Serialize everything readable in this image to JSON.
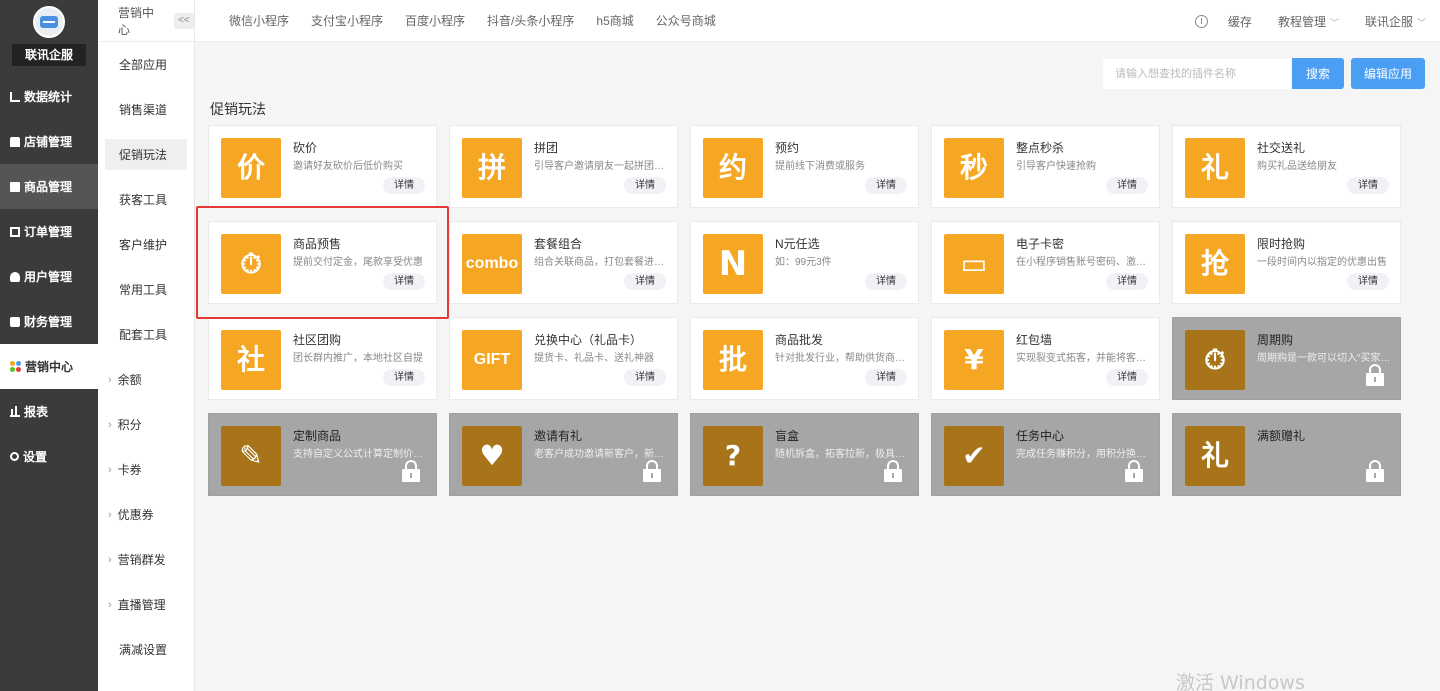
{
  "brand": {
    "name": "联讯企服"
  },
  "sidebar": {
    "items": [
      {
        "label": "数据统计",
        "icon": "chart-icon"
      },
      {
        "label": "店铺管理",
        "icon": "store-icon"
      },
      {
        "label": "商品管理",
        "icon": "goods-icon"
      },
      {
        "label": "订单管理",
        "icon": "order-icon"
      },
      {
        "label": "用户管理",
        "icon": "user-icon"
      },
      {
        "label": "财务管理",
        "icon": "finance-icon"
      },
      {
        "label": "营销中心",
        "icon": "marketing-icon"
      },
      {
        "label": "报表",
        "icon": "report-icon"
      },
      {
        "label": "设置",
        "icon": "gear-icon"
      }
    ]
  },
  "subnav": {
    "title": "营销中心",
    "collapse_label": "<<",
    "items": [
      {
        "label": "全部应用"
      },
      {
        "label": "销售渠道"
      },
      {
        "label": "促销玩法"
      },
      {
        "label": "获客工具"
      },
      {
        "label": "客户维护"
      },
      {
        "label": "常用工具"
      },
      {
        "label": "配套工具"
      },
      {
        "label": "余额"
      },
      {
        "label": "积分"
      },
      {
        "label": "卡券"
      },
      {
        "label": "优惠券"
      },
      {
        "label": "营销群发"
      },
      {
        "label": "直播管理"
      },
      {
        "label": "满减设置"
      }
    ]
  },
  "topbar": {
    "tabs": [
      "微信小程序",
      "支付宝小程序",
      "百度小程序",
      "抖音/头条小程序",
      "h5商城",
      "公众号商城"
    ],
    "cache": "缓存",
    "tutorial": "教程管理",
    "account": "联讯企服"
  },
  "toolbar": {
    "search_placeholder": "请输入想查找的插件名称",
    "search_button": "搜索",
    "edit_button": "编辑应用"
  },
  "section": {
    "title": "促销玩法"
  },
  "detail_label": "详情",
  "cards": [
    {
      "name": "砍价",
      "desc": "邀请好友砍价后低价购买",
      "glyph": "价",
      "icon": "bargain-icon",
      "locked": false
    },
    {
      "name": "拼团",
      "desc": "引导客户邀请朋友一起拼团购买",
      "glyph": "拼",
      "icon": "group-buy-icon",
      "locked": false
    },
    {
      "name": "预约",
      "desc": "提前线下消费或服务",
      "glyph": "约",
      "icon": "reservation-icon",
      "locked": false
    },
    {
      "name": "整点秒杀",
      "desc": "引导客户快速抢购",
      "glyph": "秒",
      "icon": "flash-sale-icon",
      "locked": false
    },
    {
      "name": "社交送礼",
      "desc": "购买礼品送给朋友",
      "glyph": "礼",
      "icon": "gift-icon",
      "locked": false
    },
    {
      "name": "商品预售",
      "desc": "提前交付定金，尾款享受优惠",
      "glyph": "⏱",
      "icon": "presale-bag-icon",
      "locked": false
    },
    {
      "name": "套餐组合",
      "desc": "组合关联商品，打包套餐进行销售",
      "glyph": "combo",
      "icon": "combo-icon",
      "locked": false
    },
    {
      "name": "N元任选",
      "desc": "如：99元3件",
      "glyph": "N",
      "icon": "n-yuan-icon",
      "locked": false
    },
    {
      "name": "电子卡密",
      "desc": "在小程序销售账号密码、激活码等",
      "glyph": "▭",
      "icon": "card-key-icon",
      "locked": false
    },
    {
      "name": "限时抢购",
      "desc": "一段时间内以指定的优惠出售",
      "glyph": "抢",
      "icon": "limited-time-icon",
      "locked": false
    },
    {
      "name": "社区团购",
      "desc": "团长群内推广，本地社区自提",
      "glyph": "社",
      "icon": "community-icon",
      "locked": false
    },
    {
      "name": "兑换中心（礼品卡）",
      "desc": "提货卡、礼品卡、送礼神器",
      "glyph": "GIFT",
      "icon": "gift-card-icon",
      "locked": false
    },
    {
      "name": "商品批发",
      "desc": "针对批发行业，帮助供货商快速拓客",
      "glyph": "批",
      "icon": "wholesale-icon",
      "locked": false
    },
    {
      "name": "红包墙",
      "desc": "实现裂变式拓客，并能将客户沉淀",
      "glyph": "¥",
      "icon": "red-packet-icon",
      "locked": false
    },
    {
      "name": "周期购",
      "desc": "周期购是一款可以切入“买家复购”的应用",
      "glyph": "⏱",
      "icon": "periodic-icon",
      "locked": true
    },
    {
      "name": "定制商品",
      "desc": "支持自定义公式计算定制价格的应用",
      "glyph": "✎",
      "icon": "custom-goods-icon",
      "locked": true
    },
    {
      "name": "邀请有礼",
      "desc": "老客户成功邀请新客户，新老客户都有奖励",
      "glyph": "♥",
      "icon": "invite-icon",
      "locked": true
    },
    {
      "name": "盲盒",
      "desc": "随机拆盒，拓客拉新，极具趣味性",
      "glyph": "?",
      "icon": "blind-box-icon",
      "locked": true
    },
    {
      "name": "任务中心",
      "desc": "完成任务赚积分，用积分换商品",
      "glyph": "✔",
      "icon": "task-icon",
      "locked": true
    },
    {
      "name": "满额赠礼",
      "desc": "",
      "glyph": "礼",
      "icon": "full-gift-icon",
      "locked": true
    }
  ],
  "watermark": "激活 Windows",
  "colors": {
    "accent": "#4a9ff5",
    "icon_bg": "#f5a623",
    "locked_bg": "#a6a6a6",
    "highlight": "#e53935"
  }
}
